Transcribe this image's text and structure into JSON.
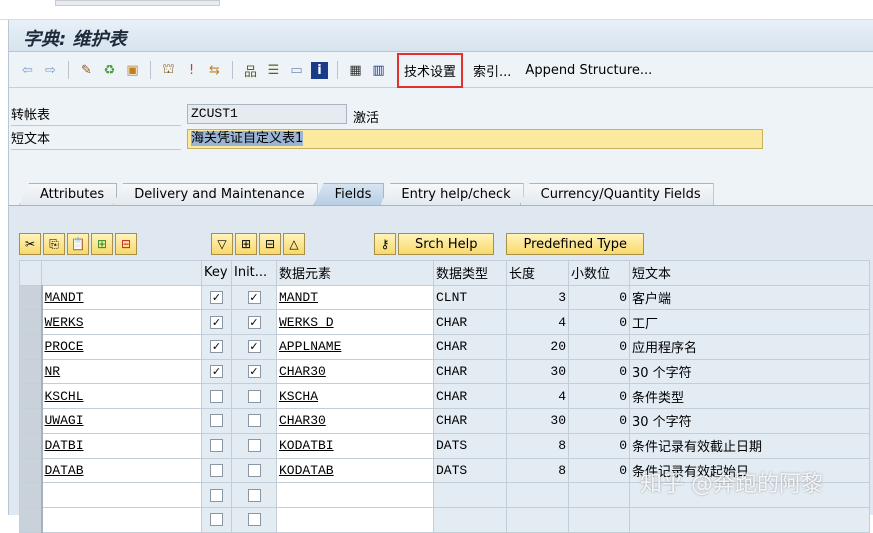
{
  "title": "字典: 维护表",
  "toolbar": {
    "icons": [
      "back-icon",
      "forward-icon",
      "edit-icon",
      "display-change-icon",
      "check-icon",
      "activate-icon",
      "where-used-icon",
      "navigate-icon",
      "hierarchy-icon",
      "object-list-icon",
      "display-list-icon",
      "info-icon",
      "structure-icon",
      "table-icon"
    ],
    "tech_settings": "技术设置",
    "indexes": "索引...",
    "append_structure": "Append Structure..."
  },
  "header": {
    "table_label": "转帐表",
    "table_value": "ZCUST1",
    "status": "激活",
    "short_text_label": "短文本",
    "short_text_value": "海关凭证自定义表1"
  },
  "tabs": [
    "Attributes",
    "Delivery and Maintenance",
    "Fields",
    "Entry help/check",
    "Currency/Quantity Fields"
  ],
  "active_tab": "Fields",
  "table_tools": {
    "srch_help": "Srch Help",
    "predefined_type": "Predefined Type"
  },
  "columns": [
    "",
    "Key",
    "Init...",
    "数据元素",
    "数据类型",
    "长度",
    "小数位",
    "短文本"
  ],
  "rows": [
    {
      "field": "MANDT",
      "key": true,
      "init": true,
      "element": "MANDT",
      "type": "CLNT",
      "length": "3",
      "decimals": "0",
      "text": "客户端"
    },
    {
      "field": "WERKS",
      "key": true,
      "init": true,
      "element": "WERKS_D",
      "type": "CHAR",
      "length": "4",
      "decimals": "0",
      "text": "工厂"
    },
    {
      "field": "PROCE",
      "key": true,
      "init": true,
      "element": "APPLNAME",
      "type": "CHAR",
      "length": "20",
      "decimals": "0",
      "text": "应用程序名"
    },
    {
      "field": "NR",
      "key": true,
      "init": true,
      "element": "CHAR30",
      "type": "CHAR",
      "length": "30",
      "decimals": "0",
      "text": "30 个字符"
    },
    {
      "field": "KSCHL",
      "key": false,
      "init": false,
      "element": "KSCHA",
      "type": "CHAR",
      "length": "4",
      "decimals": "0",
      "text": "条件类型"
    },
    {
      "field": "UWAGI",
      "key": false,
      "init": false,
      "element": "CHAR30",
      "type": "CHAR",
      "length": "30",
      "decimals": "0",
      "text": "30 个字符"
    },
    {
      "field": "DATBI",
      "key": false,
      "init": false,
      "element": "KODATBI",
      "type": "DATS",
      "length": "8",
      "decimals": "0",
      "text": "条件记录有效截止日期"
    },
    {
      "field": "DATAB",
      "key": false,
      "init": false,
      "element": "KODATAB",
      "type": "DATS",
      "length": "8",
      "decimals": "0",
      "text": "条件记录有效起始日"
    },
    {
      "field": "",
      "key": false,
      "init": false,
      "element": "",
      "type": "",
      "length": "",
      "decimals": "",
      "text": ""
    },
    {
      "field": "",
      "key": false,
      "init": false,
      "element": "",
      "type": "",
      "length": "",
      "decimals": "",
      "text": ""
    }
  ],
  "watermark": "知乎 @奔跑的阿黎"
}
